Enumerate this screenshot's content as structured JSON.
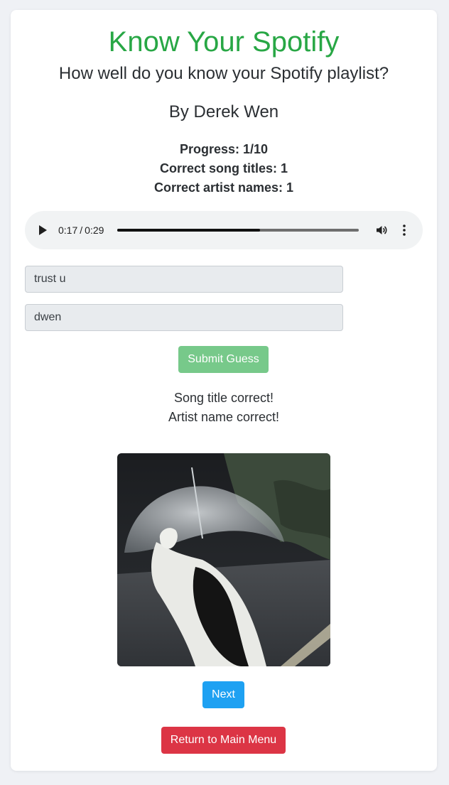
{
  "header": {
    "title": "Know Your Spotify",
    "subtitle": "How well do you know your Spotify playlist?",
    "author": "By Derek Wen"
  },
  "stats": {
    "progress": "Progress: 1/10",
    "song_titles": "Correct song titles: 1",
    "artist_names": "Correct artist names: 1"
  },
  "player": {
    "current_time": "0:17",
    "separator": "/",
    "duration": "0:29",
    "progress_fraction": 0.59,
    "icons": [
      "play-icon",
      "volume-icon",
      "more-vertical-icon"
    ]
  },
  "form": {
    "song_value": "trust u",
    "artist_value": "dwen",
    "submit_label": "Submit Guess"
  },
  "result": {
    "song": "Song title correct!",
    "artist": "Artist name correct!"
  },
  "actions": {
    "next_label": "Next",
    "menu_label": "Return to Main Menu"
  },
  "colors": {
    "title": "#28a745",
    "submit": "#77c98a",
    "next": "#1ea1f2",
    "menu": "#dc3545"
  }
}
